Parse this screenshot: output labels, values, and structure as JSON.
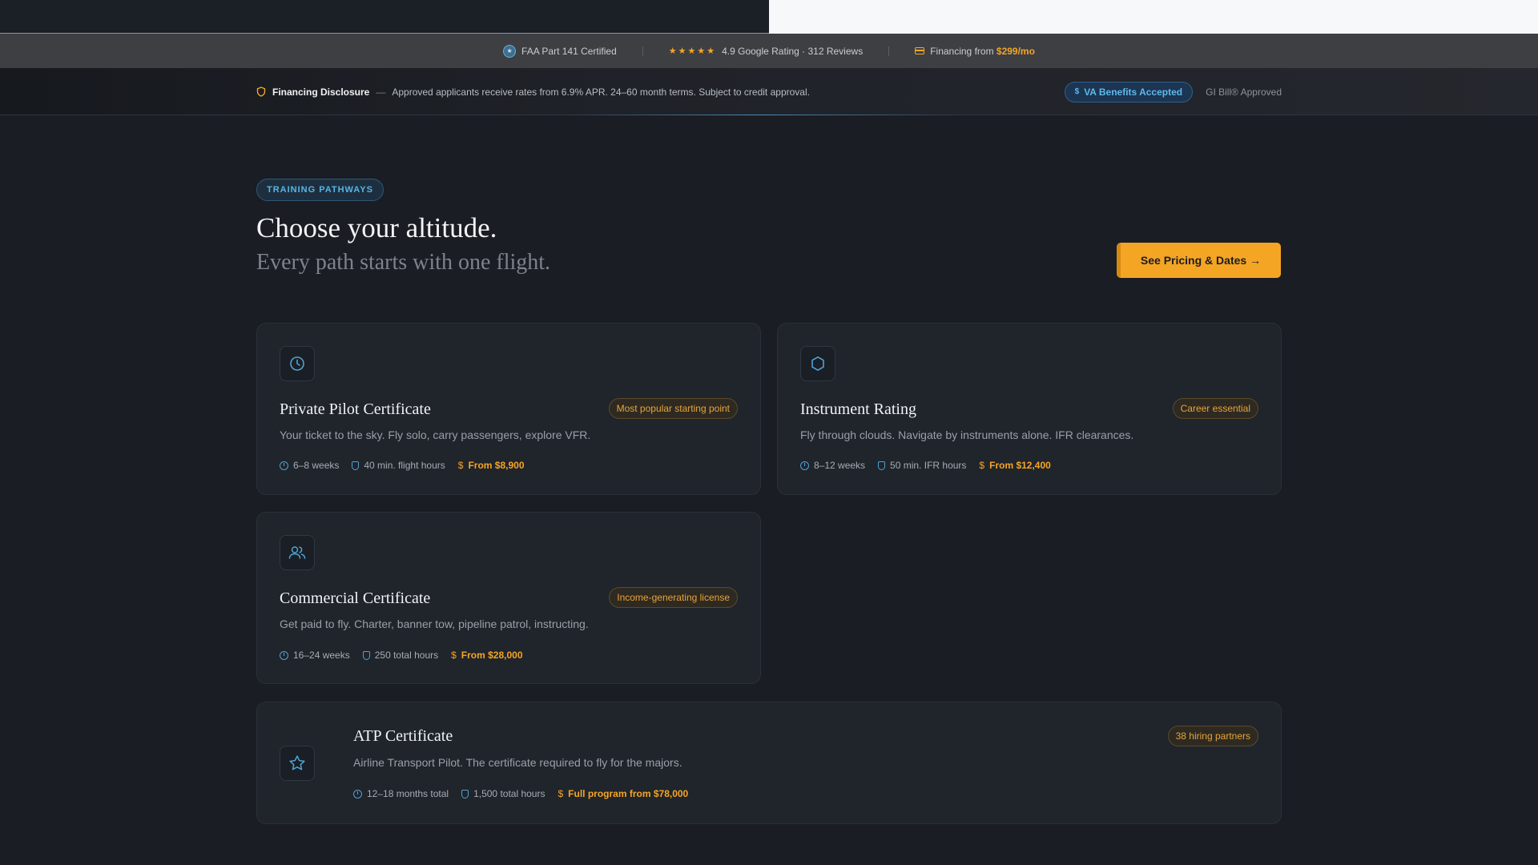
{
  "trust_bar": {
    "faa": "FAA Part 141 Certified",
    "rating": "4.9 Google Rating · 312 Reviews",
    "stars": "★★★★★",
    "financing_prefix": "Financing from ",
    "financing_amount": "$299/mo"
  },
  "disclosure": {
    "title": "Financing Disclosure",
    "dash": "—",
    "text": "Approved applicants receive rates from 6.9% APR. 24–60 month terms. Subject to credit approval.",
    "va_label": "VA Benefits Accepted",
    "gi_label": "GI Bill® Approved"
  },
  "hero": {
    "eyebrow": "TRAINING PATHWAYS",
    "headline": "Choose your altitude.",
    "subhead": "Every path starts with one flight.",
    "cta": "See Pricing & Dates →"
  },
  "programs": [
    {
      "title": "Private Pilot Certificate",
      "tag": "Most popular starting point",
      "desc": "Your ticket to the sky. Fly solo, carry passengers, explore VFR.",
      "duration": "6–8 weeks",
      "hours": "40 min. flight hours",
      "price": "From $8,900",
      "icon": "clock-icon"
    },
    {
      "title": "Instrument Rating",
      "tag": "Career essential",
      "desc": "Fly through clouds. Navigate by instruments alone. IFR clearances.",
      "duration": "8–12 weeks",
      "hours": "50 min. IFR hours",
      "price": "From $12,400",
      "icon": "hexagon-icon"
    },
    {
      "title": "Commercial Certificate",
      "tag": "Income-generating license",
      "desc": "Get paid to fly. Charter, banner tow, pipeline patrol, instructing.",
      "duration": "16–24 weeks",
      "hours": "250 total hours",
      "price": "From $28,000",
      "icon": "users-icon"
    },
    {
      "title": "ATP Certificate",
      "tag": "38 hiring partners",
      "desc": "Airline Transport Pilot. The certificate required to fly for the majors.",
      "duration": "12–18 months total",
      "hours": "1,500 total hours",
      "price": "Full program from $78,000",
      "icon": "star-icon"
    }
  ],
  "colors": {
    "accent": "#f5a524",
    "blue": "#4fa3d4",
    "background": "#1a1d23"
  }
}
